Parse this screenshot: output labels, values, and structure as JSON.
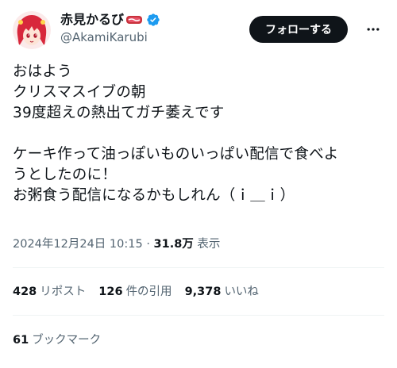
{
  "author": {
    "display_name": "赤見かるび",
    "handle": "@AkamiKarubi",
    "verified": true,
    "brand_color": "#1d9bf0"
  },
  "follow_button": {
    "label": "フォローする"
  },
  "more_icon": "more-horizontal-icon",
  "tweet": {
    "lines": [
      "おはよう",
      "クリスマスイブの朝",
      "39度超えの熱出てガチ萎えです",
      "",
      "ケーキ作って油っぽいものいっぱい配信で食べよ",
      "うとしたのに！",
      "お粥食う配信になるかもしれん（ｉ＿ｉ）"
    ],
    "timestamp": "2024年12月24日 10:15",
    "separator": "·",
    "views_count": "31.8万",
    "views_label": "表示"
  },
  "stats": {
    "reposts": {
      "count": "428",
      "label": "リポスト"
    },
    "quotes": {
      "count": "126",
      "label": "件の引用"
    },
    "likes": {
      "count": "9,378",
      "label": "いいね"
    },
    "bookmarks": {
      "count": "61",
      "label": "ブックマーク"
    }
  }
}
